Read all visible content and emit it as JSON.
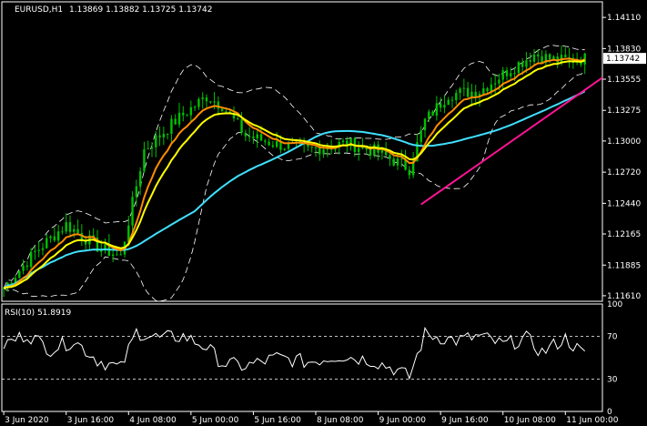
{
  "header": {
    "symbol": "EURUSD,H1",
    "ohlc": "1.13869 1.13882 1.13725 1.13742"
  },
  "price_axis": {
    "ticks": [
      "1.14110",
      "1.13830",
      "1.13555",
      "1.13275",
      "1.13000",
      "1.12720",
      "1.12440",
      "1.12165",
      "1.11885",
      "1.11610"
    ],
    "current_price": "1.13742",
    "ylim": [
      1.1156,
      1.1425
    ]
  },
  "rsi": {
    "label": "RSI(10) 51.8919",
    "ticks": [
      "100",
      "70",
      "30",
      "0"
    ],
    "levels": [
      70,
      30
    ],
    "ylim": [
      0,
      100
    ]
  },
  "time_axis": {
    "labels": [
      "3 Jun 2020",
      "3 Jun 16:00",
      "4 Jun 08:00",
      "5 Jun 00:00",
      "5 Jun 16:00",
      "8 Jun 08:00",
      "9 Jun 00:00",
      "9 Jun 16:00",
      "10 Jun 08:00",
      "11 Jun 00:00"
    ],
    "label_bars": [
      0,
      16,
      32,
      48,
      64,
      80,
      96,
      112,
      128,
      144
    ]
  },
  "colors": {
    "background": "#000000",
    "grid": "#ffffff",
    "candles": "#00c000",
    "ema_fast": "#ff8c00",
    "ema_mid": "#ffff00",
    "ma_slow": "#40e0ff",
    "bands": "#ffffff",
    "trendline": "#ff1493",
    "rsi_line": "#ffffff"
  },
  "chart_data": [
    {
      "type": "candlestick",
      "title": "EURUSD,H1",
      "bar_count": 150,
      "anchors_close": [
        [
          0,
          1.1168
        ],
        [
          8,
          1.12
        ],
        [
          16,
          1.1225
        ],
        [
          24,
          1.1205
        ],
        [
          30,
          1.1196
        ],
        [
          36,
          1.1292
        ],
        [
          44,
          1.1318
        ],
        [
          52,
          1.134
        ],
        [
          56,
          1.1332
        ],
        [
          62,
          1.1305
        ],
        [
          70,
          1.1297
        ],
        [
          78,
          1.1292
        ],
        [
          88,
          1.1298
        ],
        [
          96,
          1.129
        ],
        [
          104,
          1.1275
        ],
        [
          108,
          1.1318
        ],
        [
          114,
          1.1342
        ],
        [
          122,
          1.1345
        ],
        [
          130,
          1.1365
        ],
        [
          136,
          1.1378
        ],
        [
          142,
          1.1372
        ],
        [
          149,
          1.1374
        ]
      ],
      "overlays": [
        "EMA fast (orange)",
        "EMA mid (yellow)",
        "MA slow (cyan)",
        "Envelope bands (white dashed)"
      ],
      "trendline": {
        "from": {
          "bar": 107,
          "price": 1.1243
        },
        "to": {
          "bar": 165,
          "price": 1.1385
        }
      }
    },
    {
      "type": "line",
      "title": "RSI(10) 51.8919",
      "ylim": [
        0,
        100
      ],
      "anchors": [
        [
          0,
          62
        ],
        [
          6,
          72
        ],
        [
          12,
          58
        ],
        [
          18,
          66
        ],
        [
          24,
          48
        ],
        [
          30,
          40
        ],
        [
          34,
          74
        ],
        [
          40,
          68
        ],
        [
          46,
          70
        ],
        [
          52,
          60
        ],
        [
          56,
          45
        ],
        [
          62,
          42
        ],
        [
          70,
          50
        ],
        [
          78,
          46
        ],
        [
          86,
          52
        ],
        [
          94,
          48
        ],
        [
          100,
          40
        ],
        [
          104,
          32
        ],
        [
          108,
          72
        ],
        [
          116,
          66
        ],
        [
          122,
          70
        ],
        [
          128,
          62
        ],
        [
          134,
          68
        ],
        [
          138,
          55
        ],
        [
          144,
          68
        ],
        [
          149,
          52
        ]
      ],
      "last_value": 51.8919
    }
  ]
}
